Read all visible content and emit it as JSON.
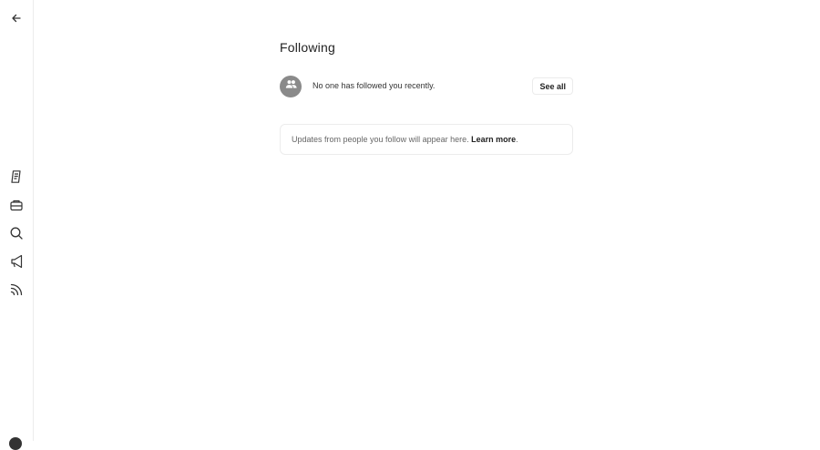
{
  "sidebar": {
    "items": [
      {
        "name": "back",
        "icon": "arrow-left-icon"
      },
      {
        "name": "notes",
        "icon": "note-icon"
      },
      {
        "name": "inbox",
        "icon": "inbox-icon"
      },
      {
        "name": "search",
        "icon": "search-icon"
      },
      {
        "name": "announcements",
        "icon": "megaphone-icon"
      },
      {
        "name": "feed",
        "icon": "rss-icon"
      }
    ]
  },
  "main": {
    "title": "Following",
    "recent_followers": {
      "empty_text": "No one has followed you recently.",
      "see_all_label": "See all"
    },
    "updates": {
      "text": "Updates from people you follow will appear here.",
      "learn_more_label": "Learn more",
      "period": "."
    }
  },
  "colors": {
    "border": "#ececec",
    "avatar_bg": "#8a8a8a",
    "text_primary": "#222222",
    "text_secondary": "#666666"
  }
}
